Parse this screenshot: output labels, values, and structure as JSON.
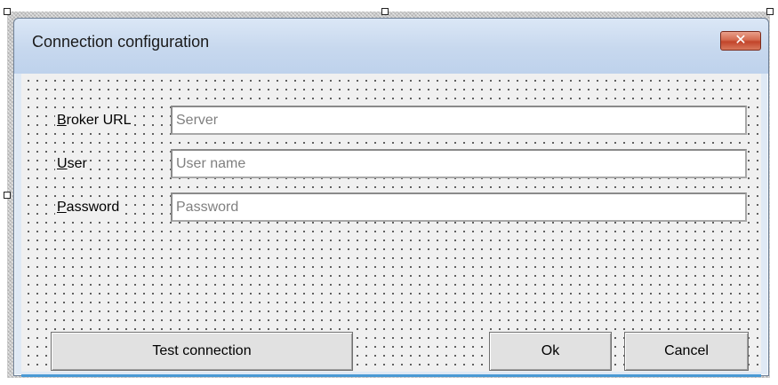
{
  "window": {
    "title": "Connection configuration",
    "close_glyph": "✕"
  },
  "fields": {
    "broker_url": {
      "label_key": "B",
      "label_rest": "roker URL",
      "value": "",
      "placeholder": "Server"
    },
    "user": {
      "label_key": "U",
      "label_rest": "ser",
      "value": "",
      "placeholder": "User name"
    },
    "password": {
      "label_key": "P",
      "label_rest": "assword",
      "value": "",
      "placeholder": "Password"
    }
  },
  "buttons": {
    "test_connection": "Test connection",
    "ok": "Ok",
    "cancel": "Cancel"
  },
  "colors": {
    "titlebar": "#c7d8ee",
    "close_button": "#c2442a",
    "form_background": "#f0f0f0",
    "grid_dot": "#3c3c3c"
  }
}
